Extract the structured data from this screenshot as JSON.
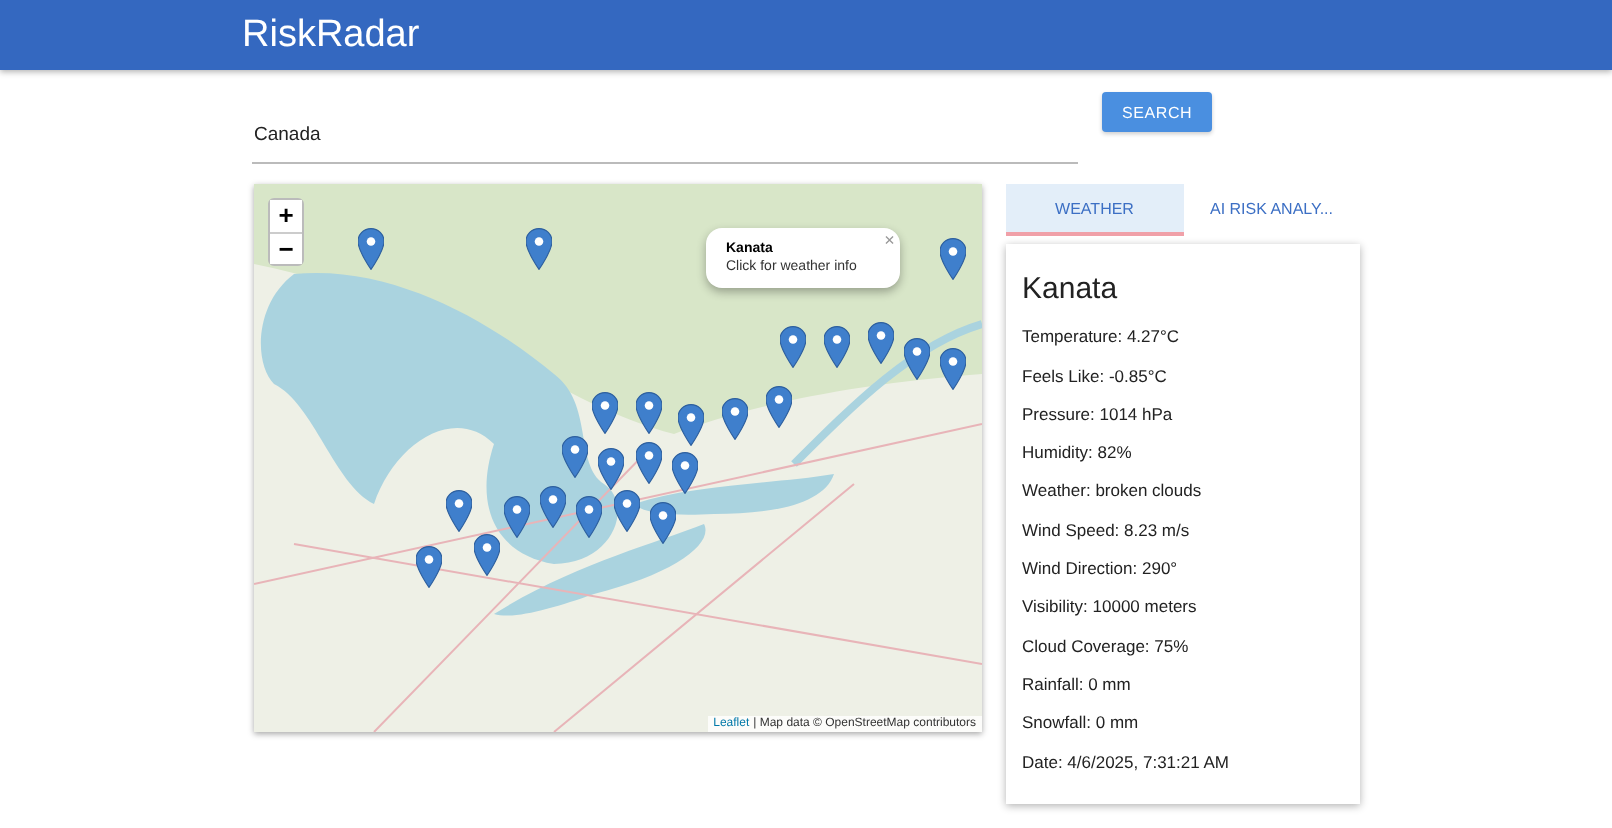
{
  "header": {
    "title": "RiskRadar"
  },
  "search": {
    "value": "Canada",
    "button": "SEARCH"
  },
  "map": {
    "zoom_in": "+",
    "zoom_out": "−",
    "popup": {
      "title": "Kanata",
      "text": "Click for weather info",
      "close": "×"
    },
    "attribution_link": "Leaflet",
    "attribution_text": "| Map data © OpenStreetMap contributors"
  },
  "tabs": [
    {
      "label": "WEATHER",
      "selected": true
    },
    {
      "label": "AI RISK ANALY...",
      "selected": false
    }
  ],
  "weather": {
    "title": "Kanata",
    "lines": [
      "Temperature: 4.27°C",
      "Feels Like: -0.85°C",
      "Pressure: 1014 hPa",
      "Humidity: 82%",
      "Weather: broken clouds",
      "Wind Speed: 8.23 m/s",
      "Wind Direction: 290°",
      "Visibility: 10000 meters",
      "Cloud Coverage: 75%",
      "Rainfall: 0 mm",
      "Snowfall: 0 mm",
      "Date: 4/6/2025, 7:31:21 AM"
    ]
  }
}
